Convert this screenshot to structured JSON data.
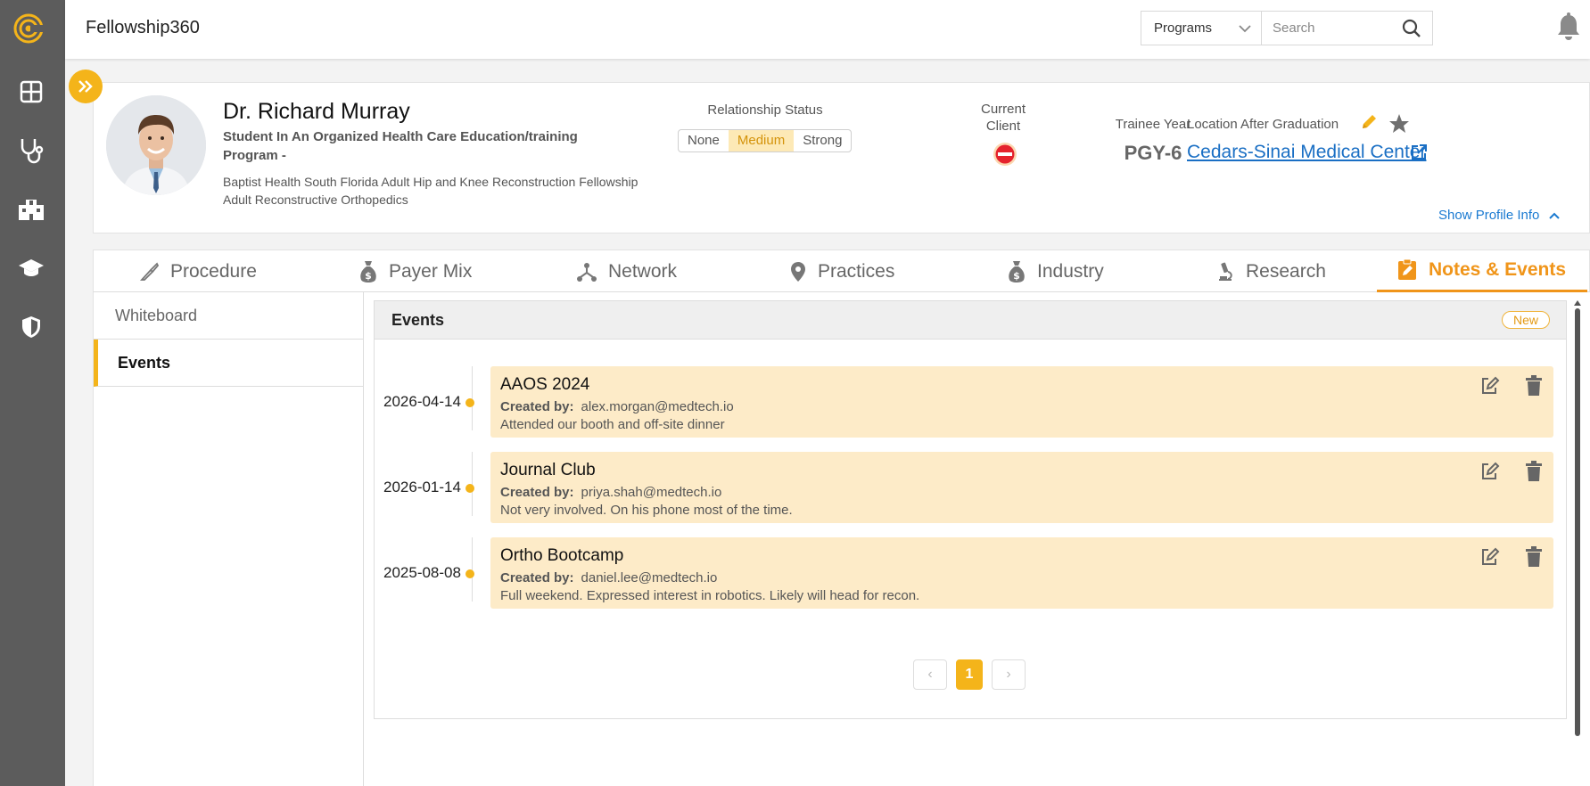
{
  "app": {
    "title": "Fellowship360"
  },
  "header": {
    "programs_select": "Programs",
    "search_placeholder": "Search"
  },
  "sidebar": {
    "items": [
      {
        "name": "dashboard-icon"
      },
      {
        "name": "stethoscope-icon"
      },
      {
        "name": "hospital-icon"
      },
      {
        "name": "graduation-cap-icon"
      },
      {
        "name": "shield-icon"
      }
    ]
  },
  "profile": {
    "name": "Dr. Richard Murray",
    "role": "Student In An Organized Health Care Education/training Program -",
    "program_line1": "Baptist Health South Florida Adult Hip and Knee Reconstruction Fellowship",
    "program_line2": "Adult Reconstructive Orthopedics",
    "relationship_label": "Relationship Status",
    "relationship_options": [
      "None",
      "Medium",
      "Strong"
    ],
    "relationship_selected": "Medium",
    "current_client_label": "Current Client",
    "trainee_year_label": "Trainee Year",
    "trainee_year": "PGY-6",
    "location_label": "Location After Graduation",
    "location_value": "Cedars-Sinai Medical Center",
    "show_profile_info": "Show Profile Info"
  },
  "tabs": [
    {
      "label": "Procedure",
      "icon": "scalpel-icon"
    },
    {
      "label": "Payer Mix",
      "icon": "money-bag-icon"
    },
    {
      "label": "Network",
      "icon": "network-icon"
    },
    {
      "label": "Practices",
      "icon": "map-pin-icon"
    },
    {
      "label": "Industry",
      "icon": "money-bag-icon"
    },
    {
      "label": "Research",
      "icon": "microscope-icon"
    },
    {
      "label": "Notes & Events",
      "icon": "note-edit-icon",
      "active": true
    }
  ],
  "subnav": {
    "items": [
      "Whiteboard",
      "Events"
    ],
    "active": "Events"
  },
  "events": {
    "header": "Events",
    "new_label": "New",
    "created_by_label": "Created by:",
    "items": [
      {
        "date": "2026-04-14",
        "title": "AAOS 2024",
        "created_by": "alex.morgan@medtech.io",
        "note": "Attended our booth and off-site dinner"
      },
      {
        "date": "2026-01-14",
        "title": "Journal Club",
        "created_by": "priya.shah@medtech.io",
        "note": "Not very involved. On his phone most of the time."
      },
      {
        "date": "2025-08-08",
        "title": "Ortho Bootcamp",
        "created_by": "daniel.lee@medtech.io",
        "note": "Full weekend. Expressed interest in robotics. Likely will head for recon."
      }
    ],
    "pagination": {
      "prev": "‹",
      "current": "1",
      "next": "›"
    }
  },
  "colors": {
    "accent": "#f4b41a",
    "active_tab": "#f0951a",
    "event_card": "#fdebc8",
    "link": "#1a6fc4",
    "sidebar": "#5c5c5c"
  }
}
